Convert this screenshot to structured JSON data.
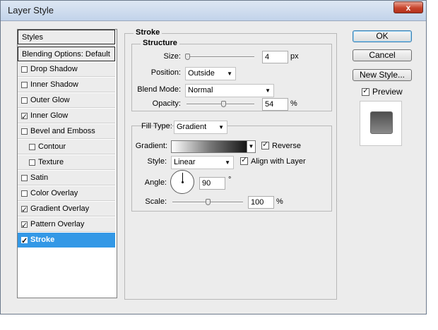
{
  "window": {
    "title": "Layer Style",
    "close_glyph": "x"
  },
  "sidebar": {
    "header": "Styles",
    "blending": "Blending Options: Default",
    "items": [
      {
        "label": "Drop Shadow",
        "checked": false
      },
      {
        "label": "Inner Shadow",
        "checked": false
      },
      {
        "label": "Outer Glow",
        "checked": false
      },
      {
        "label": "Inner Glow",
        "checked": true
      },
      {
        "label": "Bevel and Emboss",
        "checked": false
      },
      {
        "label": "Contour",
        "checked": false
      },
      {
        "label": "Texture",
        "checked": false
      },
      {
        "label": "Satin",
        "checked": false
      },
      {
        "label": "Color Overlay",
        "checked": false
      },
      {
        "label": "Gradient Overlay",
        "checked": true
      },
      {
        "label": "Pattern Overlay",
        "checked": true
      },
      {
        "label": "Stroke",
        "checked": true
      }
    ],
    "check_glyph": "✓"
  },
  "stroke": {
    "title": "Stroke",
    "structure": {
      "title": "Structure",
      "size_label": "Size:",
      "size_value": "4",
      "size_unit": "px",
      "size_level": 0.01,
      "position_label": "Position:",
      "position_value": "Outside",
      "blend_label": "Blend Mode:",
      "blend_value": "Normal",
      "opacity_label": "Opacity:",
      "opacity_value": "54",
      "opacity_unit": "%",
      "opacity_level": 0.54
    },
    "fill": {
      "fill_type_label": "Fill Type:",
      "fill_type_value": "Gradient",
      "gradient_label": "Gradient:",
      "reverse_label": "Reverse",
      "reverse_checked": true,
      "style_label": "Style:",
      "style_value": "Linear",
      "align_label": "Align with Layer",
      "align_checked": true,
      "angle_label": "Angle:",
      "angle_value": "90",
      "angle_unit": "°",
      "scale_label": "Scale:",
      "scale_value": "100",
      "scale_unit": "%",
      "scale_level": 0.5
    }
  },
  "buttons": {
    "ok": "OK",
    "cancel": "Cancel",
    "new_style": "New Style...",
    "preview_label": "Preview",
    "preview_checked": true
  },
  "icons": {
    "dropdown_arrow": "▼",
    "check": "✓"
  }
}
